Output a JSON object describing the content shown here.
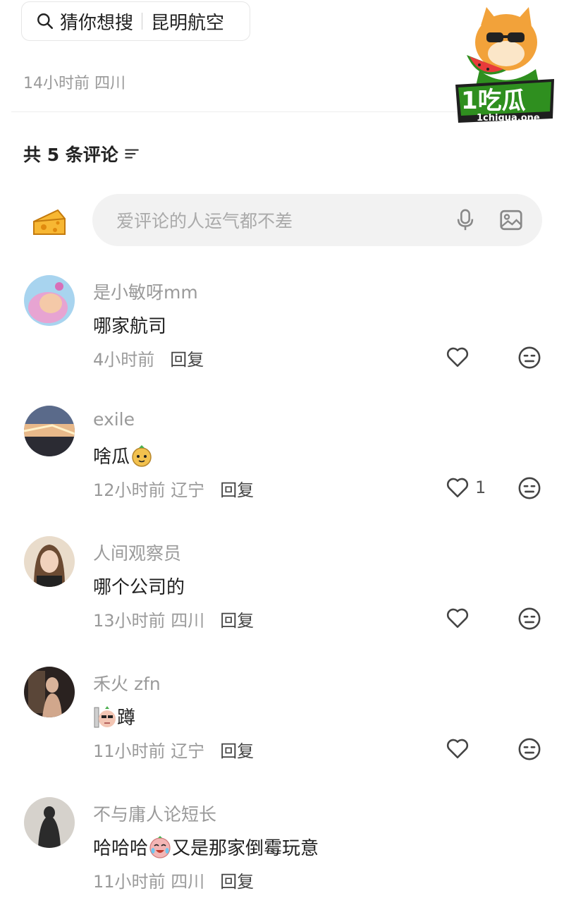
{
  "search": {
    "hint": "猜你想搜",
    "suggestion": "昆明航空"
  },
  "post": {
    "meta": "14小时前 四川"
  },
  "comments_header": {
    "count_text": "共 5 条评论"
  },
  "composer": {
    "placeholder": "爱评论的人运气都不差"
  },
  "comments": [
    {
      "user": "是小敏呀mm",
      "text": "哪家航司",
      "time": "4小时前",
      "location": "",
      "reply": "回复",
      "likes": ""
    },
    {
      "user": "exile",
      "text": "啥瓜",
      "time": "12小时前",
      "location": "辽宁",
      "reply": "回复",
      "likes": "1"
    },
    {
      "user": "人间观察员",
      "text": "哪个公司的",
      "time": "13小时前",
      "location": "四川",
      "reply": "回复",
      "likes": ""
    },
    {
      "user": "禾火 zfn",
      "text": "蹲",
      "time": "11小时前",
      "location": "辽宁",
      "reply": "回复",
      "likes": ""
    },
    {
      "user": "不与庸人论短长",
      "text_before": "哈哈哈",
      "text_after": "又是那家倒霉玩意",
      "time": "11小时前",
      "location": "四川",
      "reply": "回复",
      "likes": ""
    }
  ],
  "watermark": {
    "brand": "1吃瓜",
    "domain": "1chigua.one"
  },
  "colors": {
    "muted_text": "#9a9a9a",
    "composer_bg": "#f2f2f2",
    "logo_green": "#2f8f1f"
  }
}
